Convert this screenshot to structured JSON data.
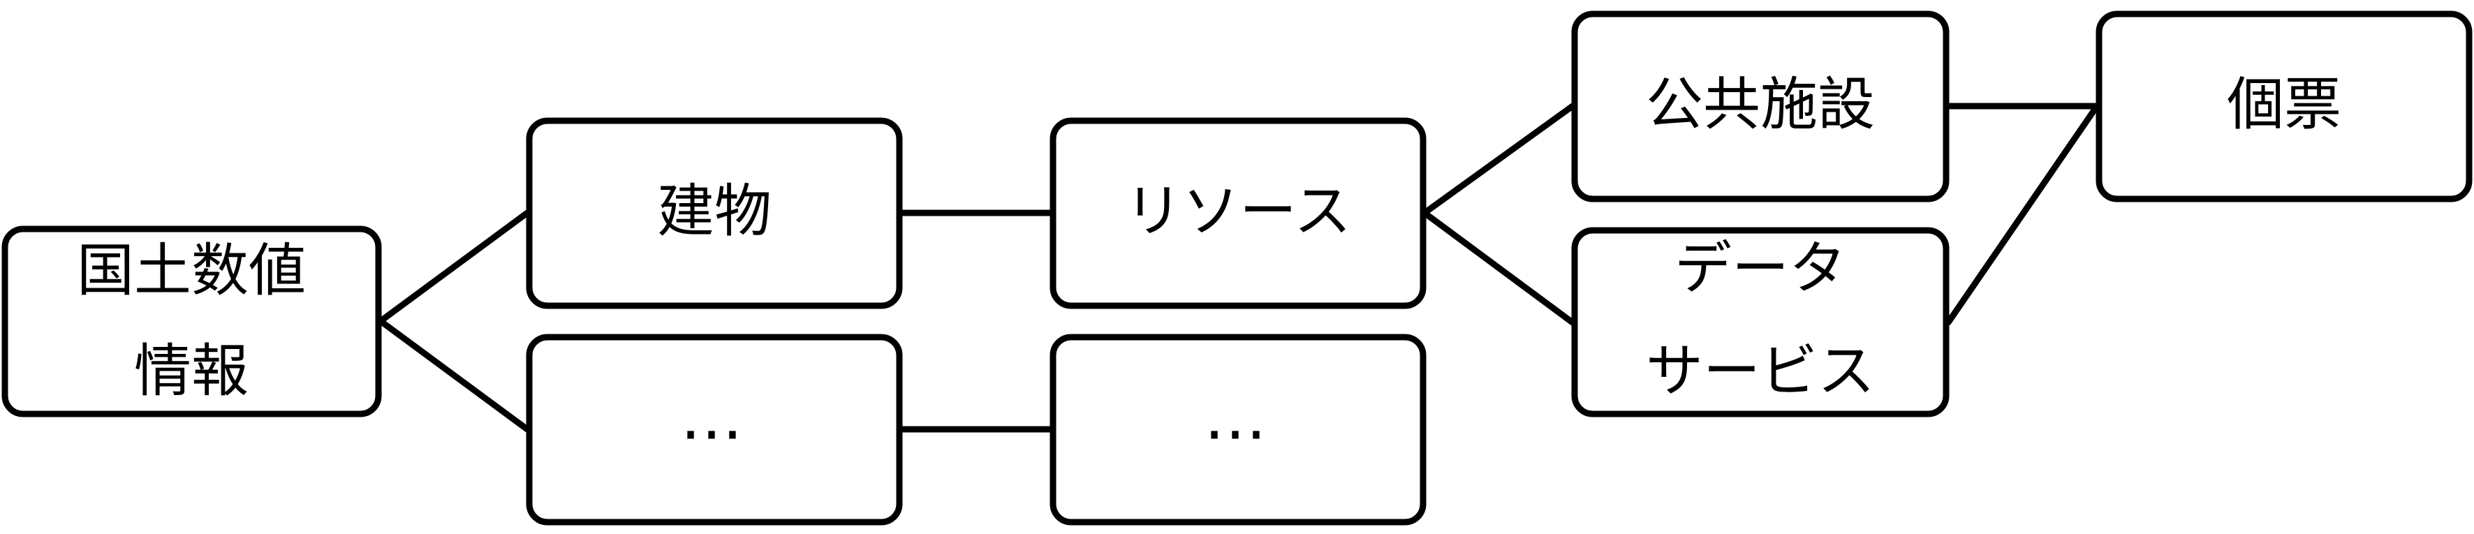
{
  "diagram": {
    "nodes": {
      "root_line1": "国土数値",
      "root_line2": "情報",
      "building": "建物",
      "ellipsis_a": "…",
      "resource": "リソース",
      "ellipsis_b": "…",
      "public_facility": "公共施設",
      "data_service_line1": "データ",
      "data_service_line2": "サービス",
      "record": "個票"
    },
    "edges": [
      [
        "root",
        "building"
      ],
      [
        "root",
        "ellipsis_a"
      ],
      [
        "building",
        "resource"
      ],
      [
        "ellipsis_a",
        "ellipsis_b"
      ],
      [
        "resource",
        "public_facility"
      ],
      [
        "resource",
        "data_service"
      ],
      [
        "public_facility",
        "record"
      ],
      [
        "data_service",
        "record"
      ]
    ]
  }
}
